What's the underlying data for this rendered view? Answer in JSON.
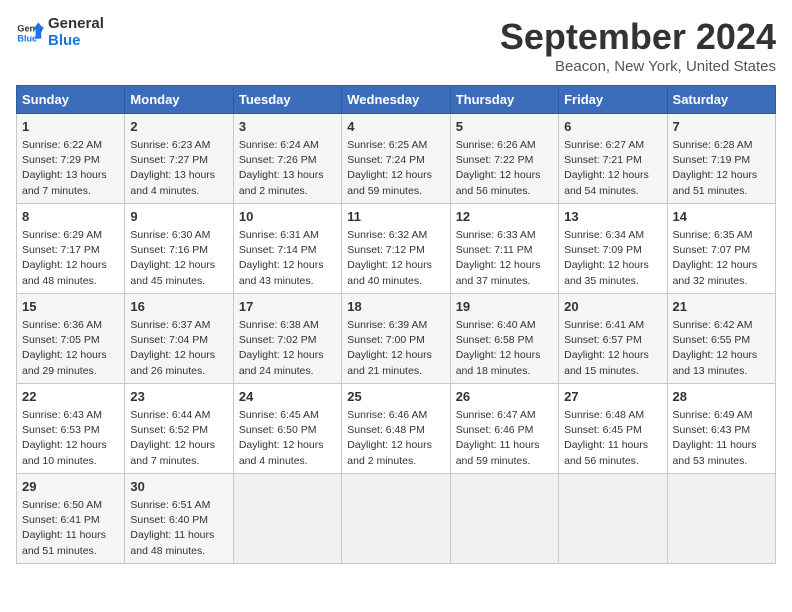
{
  "header": {
    "logo_line1": "General",
    "logo_line2": "Blue",
    "title": "September 2024",
    "subtitle": "Beacon, New York, United States"
  },
  "days_of_week": [
    "Sunday",
    "Monday",
    "Tuesday",
    "Wednesday",
    "Thursday",
    "Friday",
    "Saturday"
  ],
  "weeks": [
    [
      {
        "day": "1",
        "sunrise": "6:22 AM",
        "sunset": "7:29 PM",
        "daylight": "13 hours and 7 minutes."
      },
      {
        "day": "2",
        "sunrise": "6:23 AM",
        "sunset": "7:27 PM",
        "daylight": "13 hours and 4 minutes."
      },
      {
        "day": "3",
        "sunrise": "6:24 AM",
        "sunset": "7:26 PM",
        "daylight": "13 hours and 2 minutes."
      },
      {
        "day": "4",
        "sunrise": "6:25 AM",
        "sunset": "7:24 PM",
        "daylight": "12 hours and 59 minutes."
      },
      {
        "day": "5",
        "sunrise": "6:26 AM",
        "sunset": "7:22 PM",
        "daylight": "12 hours and 56 minutes."
      },
      {
        "day": "6",
        "sunrise": "6:27 AM",
        "sunset": "7:21 PM",
        "daylight": "12 hours and 54 minutes."
      },
      {
        "day": "7",
        "sunrise": "6:28 AM",
        "sunset": "7:19 PM",
        "daylight": "12 hours and 51 minutes."
      }
    ],
    [
      {
        "day": "8",
        "sunrise": "6:29 AM",
        "sunset": "7:17 PM",
        "daylight": "12 hours and 48 minutes."
      },
      {
        "day": "9",
        "sunrise": "6:30 AM",
        "sunset": "7:16 PM",
        "daylight": "12 hours and 45 minutes."
      },
      {
        "day": "10",
        "sunrise": "6:31 AM",
        "sunset": "7:14 PM",
        "daylight": "12 hours and 43 minutes."
      },
      {
        "day": "11",
        "sunrise": "6:32 AM",
        "sunset": "7:12 PM",
        "daylight": "12 hours and 40 minutes."
      },
      {
        "day": "12",
        "sunrise": "6:33 AM",
        "sunset": "7:11 PM",
        "daylight": "12 hours and 37 minutes."
      },
      {
        "day": "13",
        "sunrise": "6:34 AM",
        "sunset": "7:09 PM",
        "daylight": "12 hours and 35 minutes."
      },
      {
        "day": "14",
        "sunrise": "6:35 AM",
        "sunset": "7:07 PM",
        "daylight": "12 hours and 32 minutes."
      }
    ],
    [
      {
        "day": "15",
        "sunrise": "6:36 AM",
        "sunset": "7:05 PM",
        "daylight": "12 hours and 29 minutes."
      },
      {
        "day": "16",
        "sunrise": "6:37 AM",
        "sunset": "7:04 PM",
        "daylight": "12 hours and 26 minutes."
      },
      {
        "day": "17",
        "sunrise": "6:38 AM",
        "sunset": "7:02 PM",
        "daylight": "12 hours and 24 minutes."
      },
      {
        "day": "18",
        "sunrise": "6:39 AM",
        "sunset": "7:00 PM",
        "daylight": "12 hours and 21 minutes."
      },
      {
        "day": "19",
        "sunrise": "6:40 AM",
        "sunset": "6:58 PM",
        "daylight": "12 hours and 18 minutes."
      },
      {
        "day": "20",
        "sunrise": "6:41 AM",
        "sunset": "6:57 PM",
        "daylight": "12 hours and 15 minutes."
      },
      {
        "day": "21",
        "sunrise": "6:42 AM",
        "sunset": "6:55 PM",
        "daylight": "12 hours and 13 minutes."
      }
    ],
    [
      {
        "day": "22",
        "sunrise": "6:43 AM",
        "sunset": "6:53 PM",
        "daylight": "12 hours and 10 minutes."
      },
      {
        "day": "23",
        "sunrise": "6:44 AM",
        "sunset": "6:52 PM",
        "daylight": "12 hours and 7 minutes."
      },
      {
        "day": "24",
        "sunrise": "6:45 AM",
        "sunset": "6:50 PM",
        "daylight": "12 hours and 4 minutes."
      },
      {
        "day": "25",
        "sunrise": "6:46 AM",
        "sunset": "6:48 PM",
        "daylight": "12 hours and 2 minutes."
      },
      {
        "day": "26",
        "sunrise": "6:47 AM",
        "sunset": "6:46 PM",
        "daylight": "11 hours and 59 minutes."
      },
      {
        "day": "27",
        "sunrise": "6:48 AM",
        "sunset": "6:45 PM",
        "daylight": "11 hours and 56 minutes."
      },
      {
        "day": "28",
        "sunrise": "6:49 AM",
        "sunset": "6:43 PM",
        "daylight": "11 hours and 53 minutes."
      }
    ],
    [
      {
        "day": "29",
        "sunrise": "6:50 AM",
        "sunset": "6:41 PM",
        "daylight": "11 hours and 51 minutes."
      },
      {
        "day": "30",
        "sunrise": "6:51 AM",
        "sunset": "6:40 PM",
        "daylight": "11 hours and 48 minutes."
      },
      {
        "day": "",
        "sunrise": "",
        "sunset": "",
        "daylight": ""
      },
      {
        "day": "",
        "sunrise": "",
        "sunset": "",
        "daylight": ""
      },
      {
        "day": "",
        "sunrise": "",
        "sunset": "",
        "daylight": ""
      },
      {
        "day": "",
        "sunrise": "",
        "sunset": "",
        "daylight": ""
      },
      {
        "day": "",
        "sunrise": "",
        "sunset": "",
        "daylight": ""
      }
    ]
  ],
  "labels": {
    "sunrise_prefix": "Sunrise: ",
    "sunset_prefix": "Sunset: ",
    "daylight_prefix": "Daylight: "
  }
}
